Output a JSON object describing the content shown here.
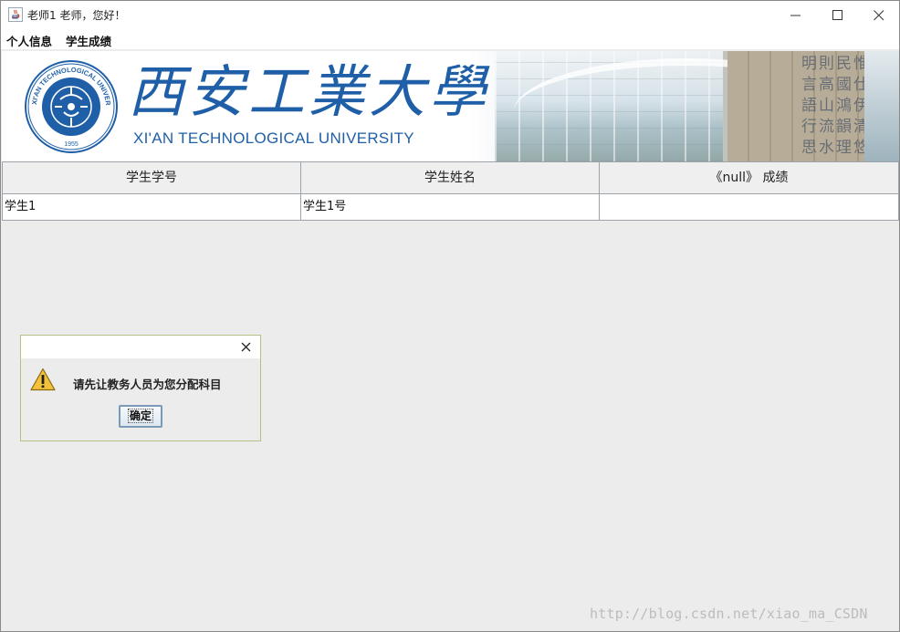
{
  "window": {
    "title": "老师1 老师，您好！"
  },
  "menu": {
    "items": [
      "个人信息",
      "学生成绩"
    ]
  },
  "banner": {
    "cn_name": "西安工業大學",
    "en_name": "XI'AN TECHNOLOGICAL UNIVERSITY",
    "seal_text": "XI'AN TECHNOLOGICAL UNIVERSITY",
    "seal_year": "1955",
    "wall_text": "惟仕伊清悠民國鴻韻理則高山流水明言語行思",
    "brand_color": "#1f5fa8"
  },
  "table": {
    "headers": [
      "学生学号",
      "学生姓名",
      "《null》  成绩"
    ],
    "rows": [
      [
        "学生1",
        "学生1号",
        ""
      ]
    ]
  },
  "dialog": {
    "message": "请先让教务人员为您分配科目",
    "ok_label": "确定",
    "icon": "warning-icon"
  },
  "watermark": "http://blog.csdn.net/xiao_ma_CSDN"
}
